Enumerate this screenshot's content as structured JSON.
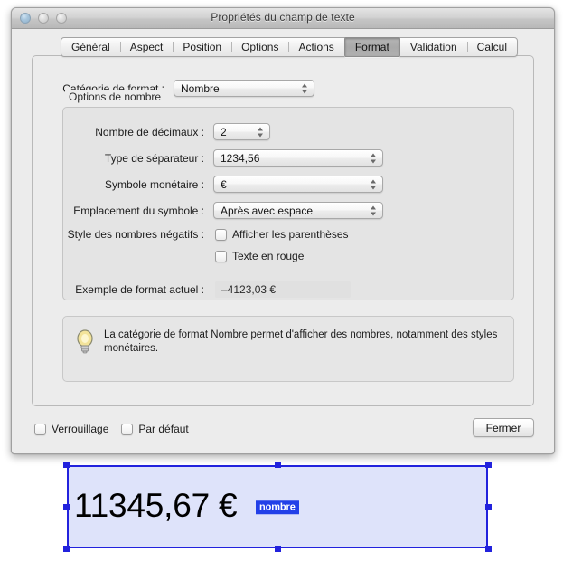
{
  "window": {
    "title": "Propriétés du champ de texte",
    "traffic_lights": [
      "close-button",
      "minimize-button",
      "zoom-button"
    ]
  },
  "tabs": [
    {
      "label": "Général",
      "active": false
    },
    {
      "label": "Aspect",
      "active": false
    },
    {
      "label": "Position",
      "active": false
    },
    {
      "label": "Options",
      "active": false
    },
    {
      "label": "Actions",
      "active": false
    },
    {
      "label": "Format",
      "active": true
    },
    {
      "label": "Validation",
      "active": false
    },
    {
      "label": "Calcul",
      "active": false
    }
  ],
  "format_tab": {
    "category": {
      "label": "Catégorie de format :",
      "value": "Nombre"
    },
    "group_title": "Options de nombre",
    "decimals": {
      "label": "Nombre de décimaux :",
      "value": "2"
    },
    "separator": {
      "label": "Type de séparateur :",
      "value": "1234,56"
    },
    "currency_symbol": {
      "label": "Symbole monétaire :",
      "value": "€"
    },
    "symbol_placement": {
      "label": "Emplacement du symbole :",
      "value": "Après avec espace"
    },
    "negative_style": {
      "label": "Style des nombres négatifs :",
      "options": [
        {
          "label": "Afficher les parenthèses",
          "checked": false
        },
        {
          "label": "Texte en rouge",
          "checked": false
        }
      ]
    },
    "example": {
      "label": "Exemple de format actuel :",
      "value": "–4123,03 €"
    },
    "tip": {
      "icon": "lightbulb-icon",
      "text": "La catégorie de format Nombre permet d'afficher des nombres, notamment des styles monétaires."
    }
  },
  "bottom_bar": {
    "lock": {
      "label": "Verrouillage",
      "checked": false
    },
    "default": {
      "label": "Par défaut",
      "checked": false
    },
    "close_button": "Fermer"
  },
  "canvas_field": {
    "text": "11345,67 €",
    "badge": "nombre",
    "badge_color": "#2240e8",
    "fill_color": "#dee3fa",
    "border_color": "#2222dd",
    "handles": [
      "handle-top-left",
      "handle-top-center",
      "handle-top-right",
      "handle-middle-left",
      "handle-middle-right",
      "handle-bottom-left",
      "handle-bottom-center",
      "handle-bottom-right"
    ]
  }
}
